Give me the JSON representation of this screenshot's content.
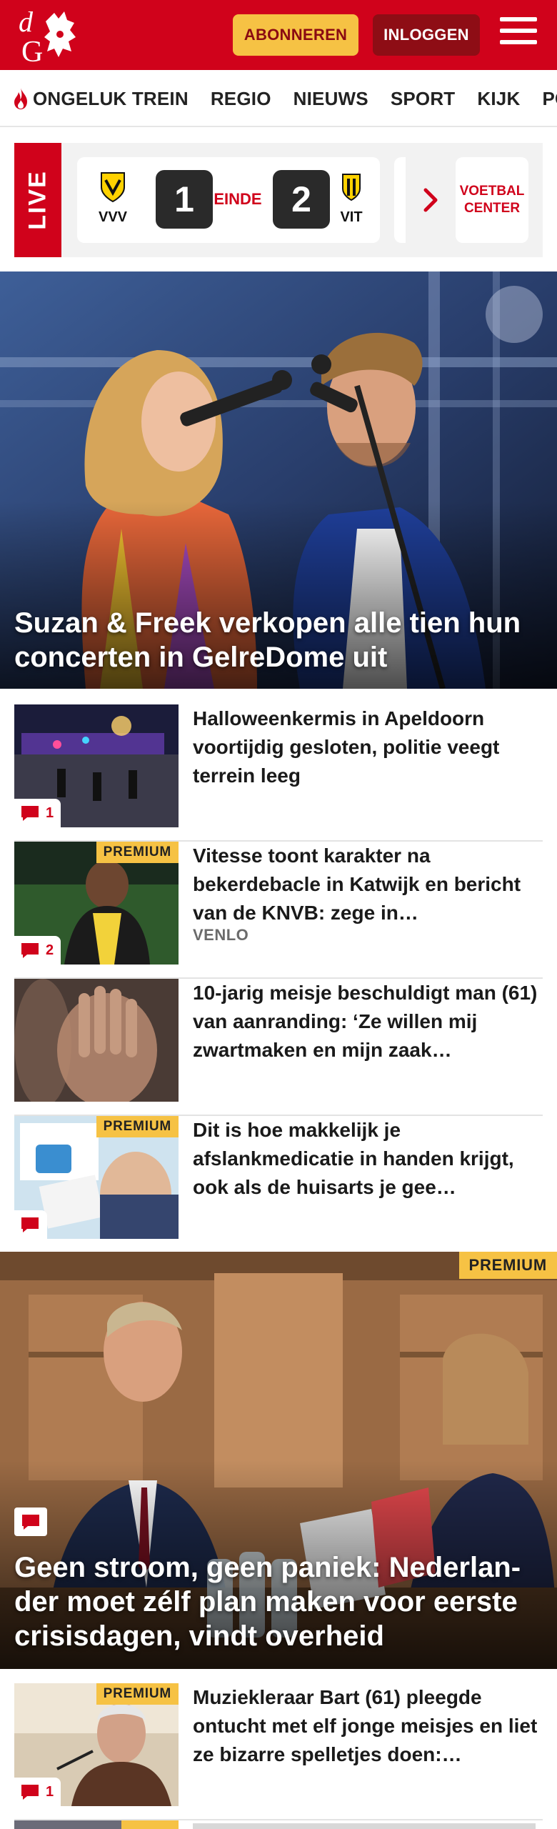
{
  "header": {
    "logo_text": "dG",
    "subscribe_label": "ABONNEREN",
    "login_label": "INLOGGEN",
    "brand_color": "#d0021b"
  },
  "nav": {
    "items": [
      "ONGELUK TREIN",
      "REGIO",
      "NIEUWS",
      "SPORT",
      "KIJK",
      "PODCAST"
    ]
  },
  "live": {
    "label": "LIVE",
    "match": {
      "home": {
        "abbr": "VVV",
        "score": "1"
      },
      "away": {
        "abbr": "VIT",
        "score": "2"
      },
      "status": "EINDE"
    },
    "voetbal_center": "VOETBAL CENTER"
  },
  "hero": {
    "title": "Suzan & Freek verkopen alle tien hun concerten in GelreDome uit"
  },
  "articles": [
    {
      "title": "Halloweenkermis in Apeldoorn voortijdig gesloten, politie veegt terrein leeg",
      "comments": "1",
      "premium": "",
      "tag": ""
    },
    {
      "title": "Vitesse toont karakter na bekerdebacle in Katwijk en bericht van de KNVB: zege in…",
      "comments": "2",
      "premium": "PREMIUM",
      "tag": "VENLO"
    },
    {
      "title": "10-jarig meisje beschuldigt man (61) van aanranding: ‘Ze willen mij zwartmaken en mijn zaak…",
      "comments": "",
      "premium": "",
      "tag": ""
    },
    {
      "title": "Dit is hoe makkelijk je afslankmedicatie in handen krijgt, ook als de huisarts je gee…",
      "comments": "",
      "premium": "PREMIUM",
      "tag": ""
    }
  ],
  "feature": {
    "premium": "PREMIUM",
    "title": "Geen stroom, geen paniek: Nederlan­der moet zélf plan maken voor eerste crisisdagen, vindt overheid"
  },
  "articles2": [
    {
      "title": "Muziekleraar Bart (61) pleegde ontucht met elf jonge meisjes en liet ze bizarre spelletjes doen:…",
      "comments": "1",
      "premium": "PREMIUM"
    }
  ],
  "colors": {
    "accent_red": "#d0021b",
    "premium_yellow": "#f6c244",
    "login_dark_red": "#8e0d15"
  }
}
